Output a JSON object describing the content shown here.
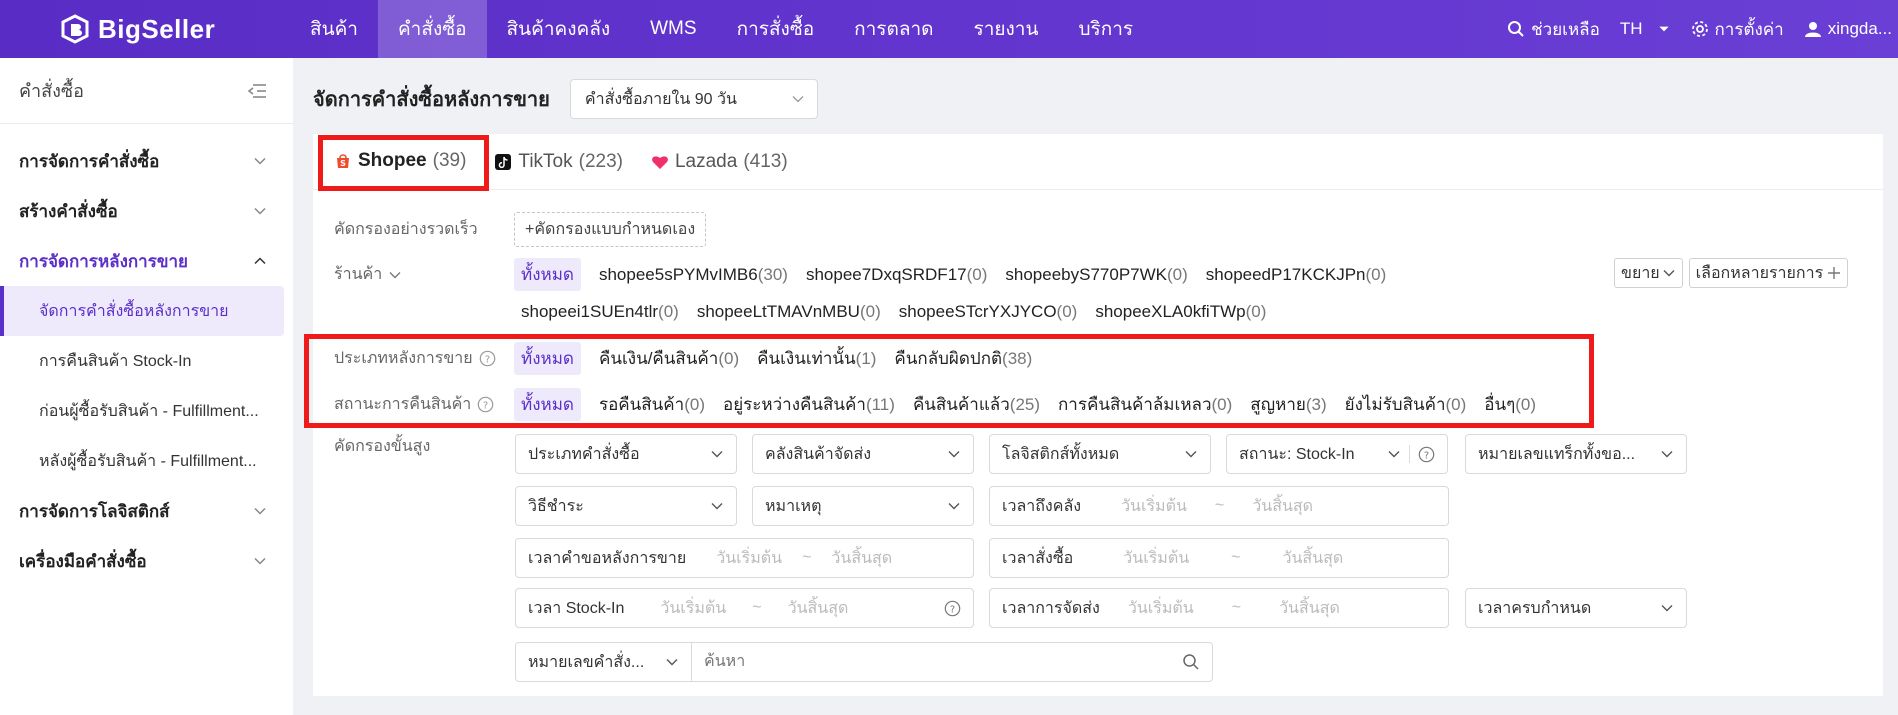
{
  "app": {
    "logo_text": "BigSeller"
  },
  "nav": {
    "items": [
      {
        "label": "สินค้า",
        "active": false
      },
      {
        "label": "คำสั่งซื้อ",
        "active": true
      },
      {
        "label": "สินค้าคงคลัง",
        "active": false
      },
      {
        "label": "WMS",
        "active": false
      },
      {
        "label": "การสั่งซื้อ",
        "active": false
      },
      {
        "label": "การตลาด",
        "active": false
      },
      {
        "label": "รายงาน",
        "active": false
      },
      {
        "label": "บริการ",
        "active": false
      }
    ],
    "help": "ช่วยเหลือ",
    "lang": "TH",
    "settings": "การตั้งค่า",
    "user": "xingda..."
  },
  "sidebar": {
    "title": "คำสั่งซื้อ",
    "sections": [
      {
        "label": "การจัดการคำสั่งซื้อ"
      },
      {
        "label": "สร้างคำสั่งซื้อ"
      },
      {
        "label": "การจัดการหลังการขาย"
      },
      {
        "label": "การจัดการโลจิสติกส์"
      },
      {
        "label": "เครื่องมือคำสั่งซื้อ"
      }
    ],
    "subitems": [
      {
        "label": "จัดการคำสั่งซื้อหลังการขาย"
      },
      {
        "label": "การคืนสินค้า Stock-In"
      },
      {
        "label": "ก่อนผู้ซื้อรับสินค้า - Fulfillment..."
      },
      {
        "label": "หลังผู้ซื้อรับสินค้า - Fulfillment..."
      }
    ]
  },
  "main": {
    "title": "จัดการคำสั่งซื้อหลังการขาย",
    "period": "คำสั่งซื้อภายใน 90 วัน",
    "tabs": [
      {
        "name": "Shopee",
        "count": "(39)"
      },
      {
        "name": "TikTok",
        "count": "(223)"
      },
      {
        "name": "Lazada",
        "count": "(413)"
      }
    ],
    "quick_filter": {
      "label": "คัดกรองอย่างรวดเร็ว",
      "add": "+คัดกรองแบบกำหนดเอง"
    },
    "store": {
      "label": "ร้านค้า",
      "all": "ทั้งหมด",
      "row1": [
        {
          "name": "shopee5sPYMvIMB6",
          "n": "(30)"
        },
        {
          "name": "shopee7DxqSRDF17",
          "n": "(0)"
        },
        {
          "name": "shopeebyS770P7WK",
          "n": "(0)"
        },
        {
          "name": "shopeedP17KCKJPn",
          "n": "(0)"
        }
      ],
      "row2": [
        {
          "name": "shopeei1SUEn4tlr",
          "n": "(0)"
        },
        {
          "name": "shopeeLtTMAVnMBU",
          "n": "(0)"
        },
        {
          "name": "shopeeSTcrYXJYCO",
          "n": "(0)"
        },
        {
          "name": "shopeeXLA0kfiTWp",
          "n": "(0)"
        }
      ],
      "expand": "ขยาย",
      "multi": "เลือกหลายรายการ"
    },
    "aftersale_type": {
      "label": "ประเภทหลังการขาย",
      "all": "ทั้งหมด",
      "items": [
        {
          "name": "คืนเงิน/คืนสินค้า",
          "n": "(0)"
        },
        {
          "name": "คืนเงินเท่านั้น",
          "n": "(1)"
        },
        {
          "name": "คืนกลับผิดปกติ",
          "n": "(38)"
        }
      ]
    },
    "return_status": {
      "label": "สถานะการคืนสินค้า",
      "all": "ทั้งหมด",
      "items": [
        {
          "name": "รอคืนสินค้า",
          "n": "(0)"
        },
        {
          "name": "อยู่ระหว่างคืนสินค้า",
          "n": "(11)"
        },
        {
          "name": "คืนสินค้าแล้ว",
          "n": "(25)"
        },
        {
          "name": "การคืนสินค้าล้มเหลว",
          "n": "(0)"
        },
        {
          "name": "สูญหาย",
          "n": "(3)"
        },
        {
          "name": "ยังไม่รับสินค้า",
          "n": "(0)"
        },
        {
          "name": "อื่นๆ",
          "n": "(0)"
        }
      ]
    },
    "advanced": {
      "label": "คัดกรองขั้นสูง",
      "order_type": "ประเภทคำสั่งซื้อ",
      "warehouse": "คลังสินค้าจัดส่ง",
      "logistics": "โลจิสติกส์ทั้งหมด",
      "stockin_status": "สถานะ: Stock-In",
      "tracking": "หมายเลขแทร็กทั้งขอ...",
      "payment": "วิธีชำระ",
      "reason": "หมาเหตุ",
      "arrive_time": "เวลาถึงคลัง",
      "request_time": "เวลาคำขอหลังการขาย",
      "order_time": "เวลาสั่งซื้อ",
      "stockin_time": "เวลา Stock-In",
      "ship_time": "เวลาการจัดส่ง",
      "due_time": "เวลาครบกำหนด",
      "start": "วันเริ่มต้น",
      "tilde": "~",
      "end": "วันสิ้นสุด",
      "search_type": "หมายเลขคำสั่ง...",
      "search_placeholder": "ค้นหา"
    }
  }
}
